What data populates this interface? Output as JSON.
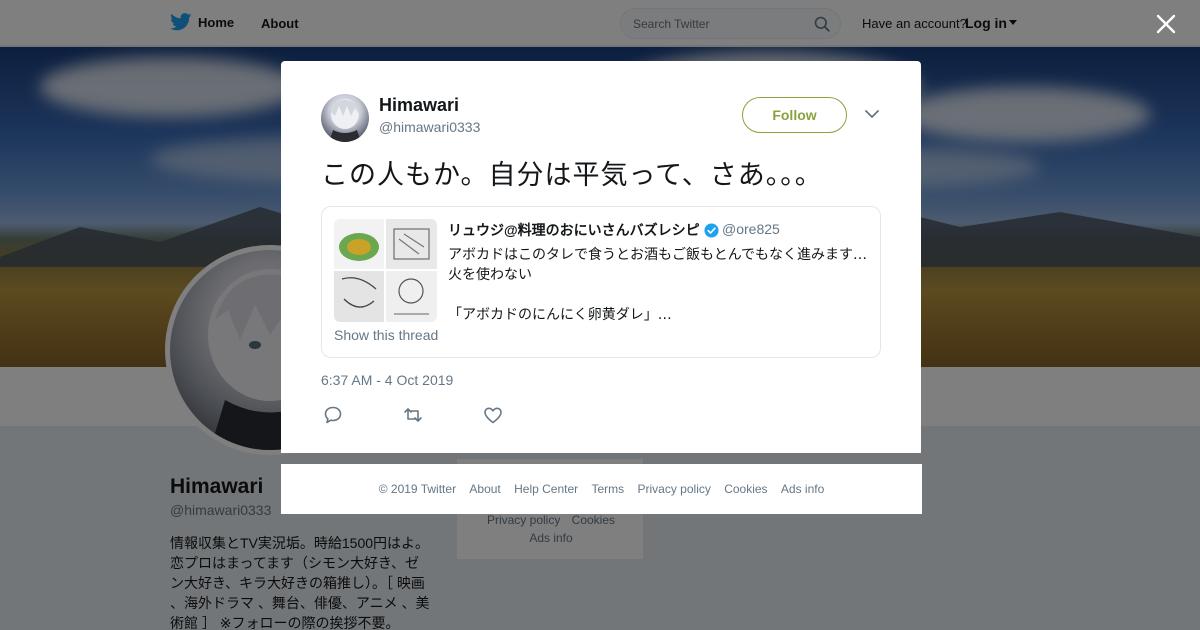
{
  "nav": {
    "home_label": "Home",
    "about_label": "About",
    "search_placeholder": "Search Twitter",
    "have_account": "Have an account?",
    "login_label": "Log in"
  },
  "profile": {
    "name": "Himawari",
    "handle": "@himawari0333",
    "bio": "情報収集とTV実況垢。時給1500円はよ。恋プロはまってます（シモン大好き、ゼン大好き、キラ大好きの箱推し）。［ 映画 、海外ドラマ 、舞台、俳優、アニメ 、美術館 ］ ※フォローの際の挨拶不要。"
  },
  "sidebar_links": [
    "Privacy policy",
    "Cookies",
    "Ads info"
  ],
  "tweet": {
    "author_name": "Himawari",
    "author_handle": "@himawari0333",
    "follow_label": "Follow",
    "text": "この人もか。自分は平気って、さあ。。。",
    "timestamp": "6:37 AM - 4 Oct 2019",
    "quote": {
      "name": "リュウジ@料理のおにいさんバズレシピ",
      "handle": "@ore825",
      "line1": "アボカドはこのタレで食うとお酒もご飯もとんでもなく進みます…",
      "line2": "火を使わない",
      "line3": "「アボカドのにんにく卵黄ダレ」…",
      "show_thread": "Show this thread",
      "verified": true
    }
  },
  "footer_links": [
    "© 2019 Twitter",
    "About",
    "Help Center",
    "Terms",
    "Privacy policy",
    "Cookies",
    "Ads info"
  ],
  "colors": {
    "follow_accent": "#8ba23c",
    "twitter_blue": "#1da1f2",
    "overlay": "rgba(0,0,0,0.5)",
    "secondary_text": "#657786"
  },
  "icons": [
    "twitter-bird-icon",
    "search-icon",
    "caret-down-icon",
    "close-icon",
    "verified-icon",
    "reply-icon",
    "retweet-icon",
    "like-icon"
  ]
}
